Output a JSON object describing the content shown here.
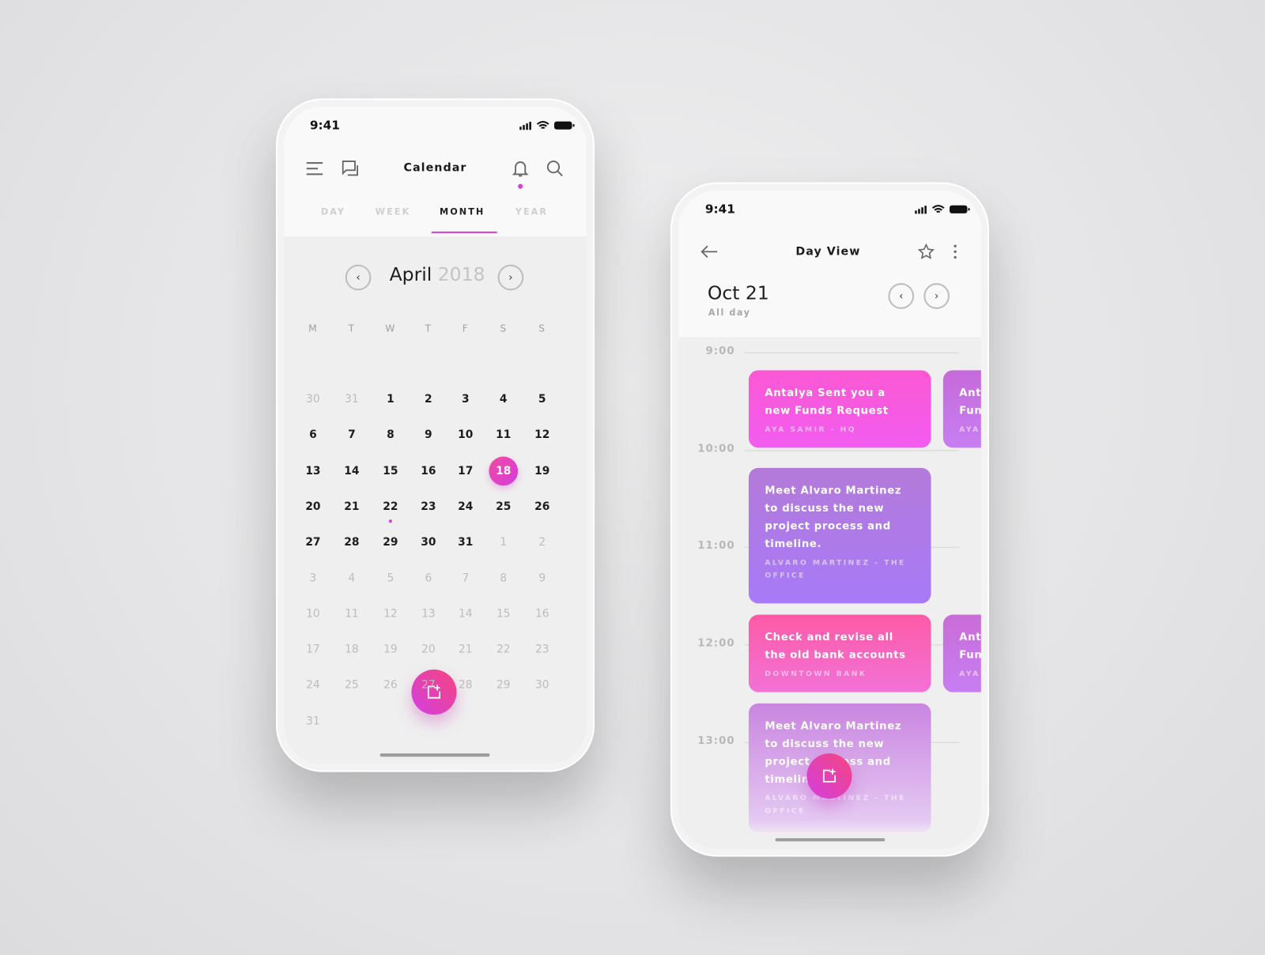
{
  "colors": {
    "accent": "#d640d6",
    "pink": "#f45ad8",
    "purple": "#a77ef0"
  },
  "month_screen": {
    "status_time": "9:41",
    "title": "Calendar",
    "icons": [
      "menu-icon",
      "chat-icon",
      "bell-icon",
      "search-icon",
      "signal-icon",
      "wifi-icon",
      "battery-icon"
    ],
    "tabs": [
      {
        "label": "DAY"
      },
      {
        "label": "WEEK"
      },
      {
        "label": "MONTH",
        "active": true
      },
      {
        "label": "YEAR"
      }
    ],
    "month": "April",
    "year": "2018",
    "weekdays": [
      "M",
      "T",
      "W",
      "T",
      "F",
      "S",
      "S"
    ],
    "weeks": [
      [
        {
          "d": "30",
          "m": 1
        },
        {
          "d": "31",
          "m": 1
        },
        {
          "d": "1"
        },
        {
          "d": "2"
        },
        {
          "d": "3"
        },
        {
          "d": "4"
        },
        {
          "d": "5"
        }
      ],
      [
        {
          "d": "6"
        },
        {
          "d": "7"
        },
        {
          "d": "8"
        },
        {
          "d": "9"
        },
        {
          "d": "10"
        },
        {
          "d": "11"
        },
        {
          "d": "12"
        }
      ],
      [
        {
          "d": "13"
        },
        {
          "d": "14"
        },
        {
          "d": "15"
        },
        {
          "d": "16"
        },
        {
          "d": "17"
        },
        {
          "d": "18",
          "sel": 1
        },
        {
          "d": "19"
        }
      ],
      [
        {
          "d": "20"
        },
        {
          "d": "21"
        },
        {
          "d": "22",
          "dot": 1
        },
        {
          "d": "23"
        },
        {
          "d": "24"
        },
        {
          "d": "25"
        },
        {
          "d": "26"
        }
      ],
      [
        {
          "d": "27"
        },
        {
          "d": "28"
        },
        {
          "d": "29"
        },
        {
          "d": "30"
        },
        {
          "d": "31"
        },
        {
          "d": "1",
          "m": 1
        },
        {
          "d": "2",
          "m": 1
        }
      ],
      [
        {
          "d": "3",
          "m": 1
        },
        {
          "d": "4",
          "m": 1
        },
        {
          "d": "5",
          "m": 1
        },
        {
          "d": "6",
          "m": 1
        },
        {
          "d": "7",
          "m": 1
        },
        {
          "d": "8",
          "m": 1
        },
        {
          "d": "9",
          "m": 1
        }
      ],
      [
        {
          "d": "10",
          "m": 1
        },
        {
          "d": "11",
          "m": 1
        },
        {
          "d": "12",
          "m": 1
        },
        {
          "d": "13",
          "m": 1
        },
        {
          "d": "14",
          "m": 1
        },
        {
          "d": "15",
          "m": 1
        },
        {
          "d": "16",
          "m": 1
        }
      ],
      [
        {
          "d": "17",
          "m": 1
        },
        {
          "d": "18",
          "m": 1
        },
        {
          "d": "19",
          "m": 1
        },
        {
          "d": "20",
          "m": 1
        },
        {
          "d": "21",
          "m": 1
        },
        {
          "d": "22",
          "m": 1
        },
        {
          "d": "23",
          "m": 1
        }
      ],
      [
        {
          "d": "24",
          "m": 1
        },
        {
          "d": "25",
          "m": 1
        },
        {
          "d": "26",
          "m": 1
        },
        {
          "d": "27",
          "m": 1
        },
        {
          "d": "28",
          "m": 1
        },
        {
          "d": "29",
          "m": 1
        },
        {
          "d": "30",
          "m": 1
        }
      ],
      [
        {
          "d": "31",
          "m": 1
        }
      ]
    ]
  },
  "day_screen": {
    "status_time": "9:41",
    "title": "Day View",
    "icons": [
      "back-arrow-icon",
      "star-icon",
      "more-vertical-icon"
    ],
    "date": "Oct 21",
    "all_day": "All day",
    "hours": [
      "9:00",
      "10:00",
      "11:00",
      "12:00",
      "13:00"
    ],
    "events": [
      {
        "title": "Antalya Sent you a new Funds Request",
        "sub": "AYA SAMIR - HQ"
      },
      {
        "title": "Meet Alvaro Martinez to discuss the new project process and timeline.",
        "sub": "ALVARO MARTINEZ - THE OFFICE"
      },
      {
        "title": "Check and revise all the old bank accounts",
        "sub": "DOWNTOWN BANK"
      },
      {
        "title": "Meet Alvaro Martinez to discuss the new project process and timeline.",
        "sub": "ALVARO MARTINEZ - THE OFFICE"
      },
      {
        "title": "Antalya Sent you a new Funds Request",
        "sub": "AYA SAMIR - HQ"
      },
      {
        "title": "Antalya Sent you a new Funds Request",
        "sub": "AYA SAMIR - HQ"
      }
    ]
  }
}
